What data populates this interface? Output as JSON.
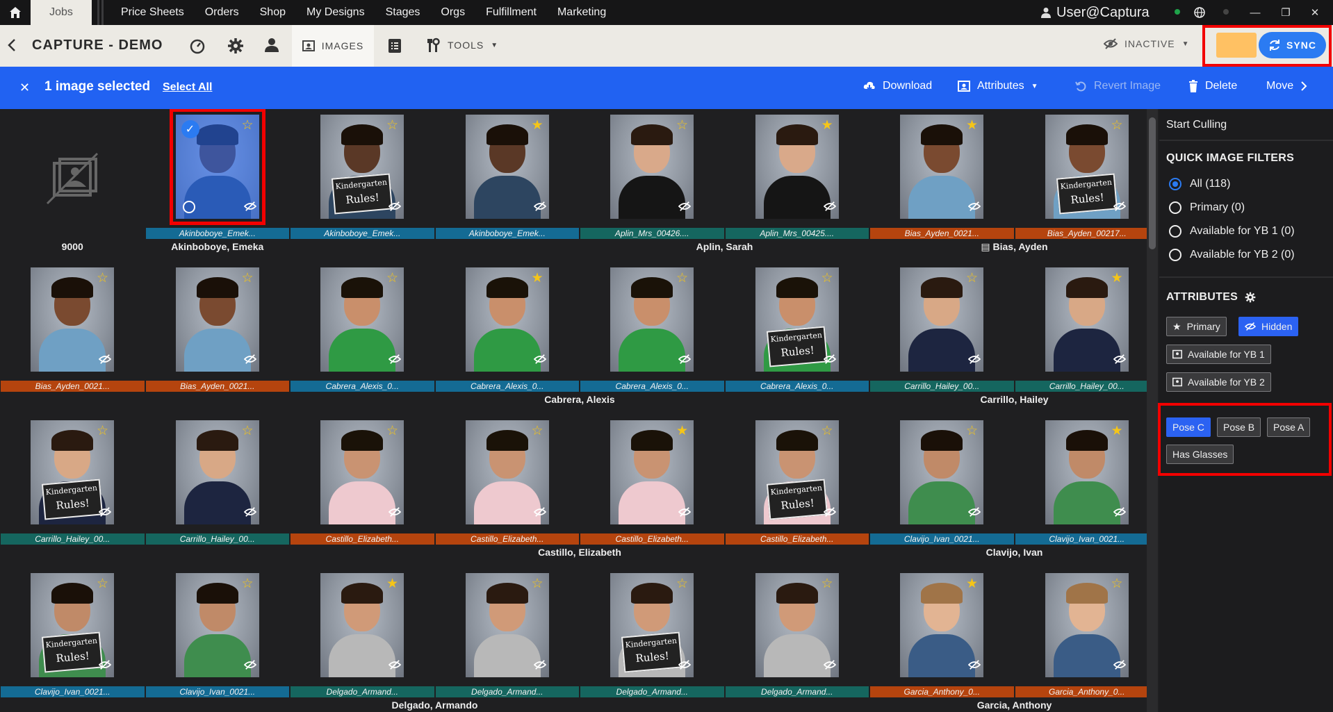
{
  "topnav": {
    "jobs_label": "Jobs",
    "items": [
      "Price Sheets",
      "Orders",
      "Shop",
      "My Designs",
      "Stages",
      "Orgs",
      "Fulfillment",
      "Marketing"
    ],
    "user": "User@Captura"
  },
  "header": {
    "title": "CAPTURE - DEMO",
    "images_tab": "IMAGES",
    "tools_label": "TOOLS",
    "status": "INACTIVE",
    "sync_label": "SYNC"
  },
  "selection": {
    "count_text": "1 image selected",
    "select_all": "Select All",
    "actions": {
      "download": "Download",
      "attributes": "Attributes",
      "revert": "Revert Image",
      "delete": "Delete",
      "move": "Move"
    }
  },
  "rows": [
    {
      "groups": [
        {
          "name": "9000",
          "center_col": 0
        },
        {
          "name": "Akinboboye, Emeka",
          "center_col": 1
        },
        {
          "name": "Aplin, Sarah",
          "center_col": 4.5
        },
        {
          "name": "Bias, Ayden",
          "center_col": 6.5,
          "icon": true
        }
      ],
      "cells": [
        {
          "placeholder": true
        },
        {
          "label": "Akinboboye_Emek...",
          "color": "blue",
          "star": "out",
          "kid": "boy-dark",
          "selected": true
        },
        {
          "label": "Akinboboye_Emek...",
          "color": "blue",
          "star": "out",
          "kid": "boy-dark",
          "sign": true
        },
        {
          "label": "Akinboboye_Emek...",
          "color": "blue",
          "star": "fill",
          "kid": "boy-dark"
        },
        {
          "label": "Aplin_Mrs_00426....",
          "color": "teal",
          "star": "out",
          "kid": "woman"
        },
        {
          "label": "Aplin_Mrs_00425....",
          "color": "teal",
          "star": "fill",
          "kid": "woman"
        },
        {
          "label": "Bias_Ayden_0021...",
          "color": "orange",
          "star": "fill",
          "kid": "boy-plaid"
        },
        {
          "label": "Bias_Ayden_00217...",
          "color": "orange",
          "star": "out",
          "kid": "boy-plaid",
          "sign": true
        }
      ]
    },
    {
      "groups": [
        {
          "name": "Cabrera, Alexis",
          "center_col": 3.5
        },
        {
          "name": "Carrillo, Hailey",
          "center_col": 6.5
        }
      ],
      "cells": [
        {
          "label": "Bias_Ayden_0021...",
          "color": "orange",
          "star": "out",
          "kid": "boy-plaid"
        },
        {
          "label": "Bias_Ayden_0021...",
          "color": "orange",
          "star": "out",
          "kid": "boy-plaid"
        },
        {
          "label": "Cabrera_Alexis_0...",
          "color": "blue",
          "star": "out",
          "kid": "girl-green"
        },
        {
          "label": "Cabrera_Alexis_0...",
          "color": "blue",
          "star": "fill",
          "kid": "girl-green"
        },
        {
          "label": "Cabrera_Alexis_0...",
          "color": "blue",
          "star": "out",
          "kid": "girl-green"
        },
        {
          "label": "Cabrera_Alexis_0...",
          "color": "blue",
          "star": "out",
          "kid": "girl-green",
          "sign": true
        },
        {
          "label": "Carrillo_Hailey_00...",
          "color": "teal",
          "star": "out",
          "kid": "girl-navy"
        },
        {
          "label": "Carrillo_Hailey_00...",
          "color": "teal",
          "star": "fill",
          "kid": "girl-navy"
        }
      ]
    },
    {
      "groups": [
        {
          "name": "Castillo, Elizabeth",
          "center_col": 3.5
        },
        {
          "name": "Clavijo, Ivan",
          "center_col": 6.5
        }
      ],
      "cells": [
        {
          "label": "Carrillo_Hailey_00...",
          "color": "teal",
          "star": "out",
          "kid": "girl-navy",
          "sign": true
        },
        {
          "label": "Carrillo_Hailey_00...",
          "color": "teal",
          "star": "out",
          "kid": "girl-navy"
        },
        {
          "label": "Castillo_Elizabeth...",
          "color": "orange",
          "star": "out",
          "kid": "girl-pink"
        },
        {
          "label": "Castillo_Elizabeth...",
          "color": "orange",
          "star": "out",
          "kid": "girl-pink"
        },
        {
          "label": "Castillo_Elizabeth...",
          "color": "orange",
          "star": "fill",
          "kid": "girl-pink"
        },
        {
          "label": "Castillo_Elizabeth...",
          "color": "orange",
          "star": "out",
          "kid": "girl-pink",
          "sign": true
        },
        {
          "label": "Clavijo_Ivan_0021...",
          "color": "blue",
          "star": "out",
          "kid": "boy-green"
        },
        {
          "label": "Clavijo_Ivan_0021...",
          "color": "blue",
          "star": "fill",
          "kid": "boy-green"
        }
      ]
    },
    {
      "groups": [
        {
          "name": "Delgado, Armando",
          "center_col": 2.5
        },
        {
          "name": "Garcia, Anthony",
          "center_col": 6.5
        }
      ],
      "cells": [
        {
          "label": "Clavijo_Ivan_0021...",
          "color": "blue",
          "star": "out",
          "kid": "boy-green",
          "sign": true
        },
        {
          "label": "Clavijo_Ivan_0021...",
          "color": "blue",
          "star": "out",
          "kid": "boy-green"
        },
        {
          "label": "Delgado_Armand...",
          "color": "teal",
          "star": "fill",
          "kid": "boy-grey"
        },
        {
          "label": "Delgado_Armand...",
          "color": "teal",
          "star": "out",
          "kid": "boy-grey"
        },
        {
          "label": "Delgado_Armand...",
          "color": "teal",
          "star": "out",
          "kid": "boy-grey",
          "sign": true
        },
        {
          "label": "Delgado_Armand...",
          "color": "teal",
          "star": "out",
          "kid": "boy-grey"
        },
        {
          "label": "Garcia_Anthony_0...",
          "color": "orange",
          "star": "fill",
          "kid": "boy-denim"
        },
        {
          "label": "Garcia_Anthony_0...",
          "color": "orange",
          "star": "out",
          "kid": "boy-denim"
        }
      ]
    }
  ],
  "sign_text": [
    "Kindergarten",
    "Rules!"
  ],
  "panel": {
    "start_culling": "Start Culling",
    "quick_filters_title": "QUICK IMAGE FILTERS",
    "filters": [
      {
        "label": "All (118)",
        "selected": true
      },
      {
        "label": "Primary (0)",
        "selected": false
      },
      {
        "label": "Available for YB 1 (0)",
        "selected": false
      },
      {
        "label": "Available for YB 2 (0)",
        "selected": false
      }
    ],
    "attributes_title": "ATTRIBUTES",
    "attr_chips": [
      {
        "label": "Primary",
        "icon": "star-icon",
        "on": false
      },
      {
        "label": "Hidden",
        "icon": "eye-off-icon",
        "on": true
      },
      {
        "label": "Available for YB 1",
        "icon": "yearbook-icon",
        "on": false
      },
      {
        "label": "Available for YB 2",
        "icon": "yearbook-icon",
        "on": false
      }
    ],
    "pose_chips": [
      {
        "label": "Pose C",
        "on": true
      },
      {
        "label": "Pose B",
        "on": false
      },
      {
        "label": "Pose A",
        "on": false
      },
      {
        "label": "Has Glasses",
        "on": false
      }
    ]
  },
  "colors": {
    "accent": "#2162f2",
    "label_blue": "#146b94",
    "label_teal": "#15665f",
    "label_orange": "#b5440e",
    "highlight": "#f20000"
  }
}
